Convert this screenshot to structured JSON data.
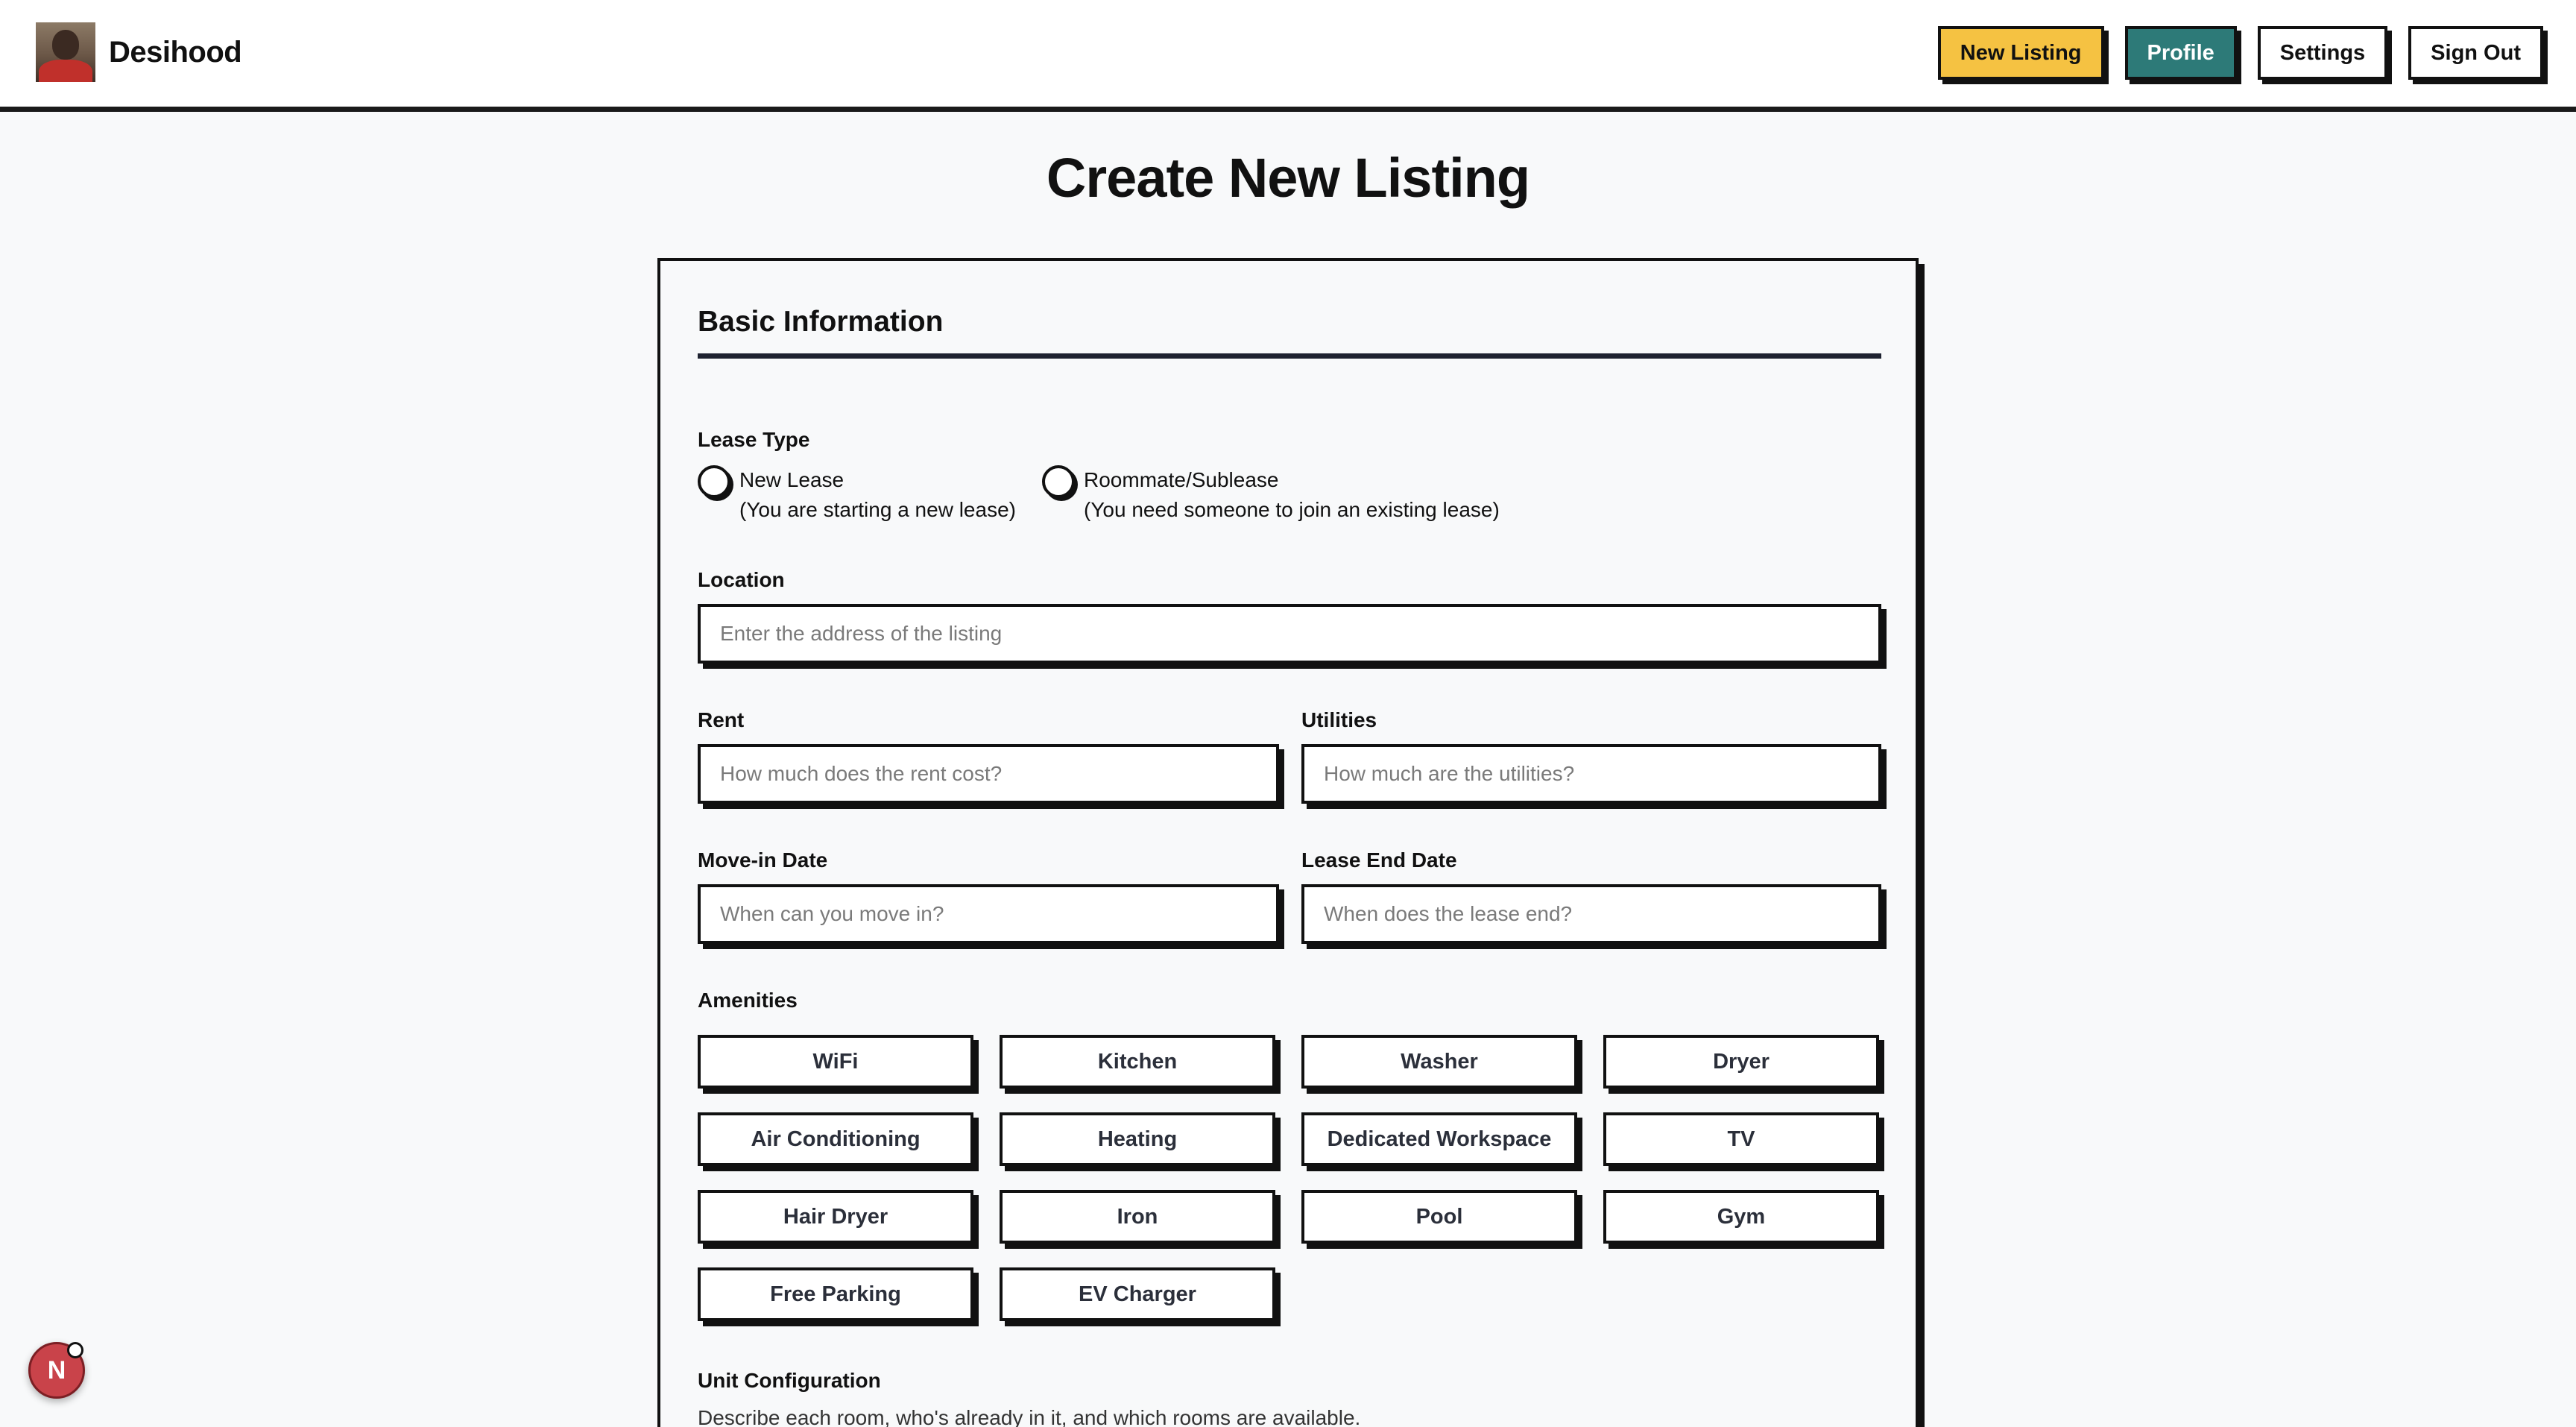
{
  "header": {
    "brand": "Desihood",
    "nav": {
      "new_listing": "New Listing",
      "profile": "Profile",
      "settings": "Settings",
      "sign_out": "Sign Out"
    }
  },
  "page": {
    "title": "Create New Listing"
  },
  "basic_info": {
    "section_title": "Basic Information",
    "lease_type": {
      "label": "Lease Type",
      "options": [
        {
          "title": "New Lease",
          "subtitle": "(You are starting a new lease)"
        },
        {
          "title": "Roommate/Sublease",
          "subtitle": "(You need someone to join an existing lease)"
        }
      ]
    },
    "location": {
      "label": "Location",
      "placeholder": "Enter the address of the listing"
    },
    "rent": {
      "label": "Rent",
      "placeholder": "How much does the rent cost?"
    },
    "utilities": {
      "label": "Utilities",
      "placeholder": "How much are the utilities?"
    },
    "move_in": {
      "label": "Move-in Date",
      "placeholder": "When can you move in?"
    },
    "lease_end": {
      "label": "Lease End Date",
      "placeholder": "When does the lease end?"
    },
    "amenities": {
      "label": "Amenities",
      "items": [
        "WiFi",
        "Kitchen",
        "Washer",
        "Dryer",
        "Air Conditioning",
        "Heating",
        "Dedicated Workspace",
        "TV",
        "Hair Dryer",
        "Iron",
        "Pool",
        "Gym",
        "Free Parking",
        "EV Charger"
      ]
    },
    "unit_config": {
      "label": "Unit Configuration",
      "description": "Describe each room, who's already in it, and which rooms are available."
    }
  },
  "fab": {
    "letter": "N"
  },
  "colors": {
    "accent_yellow": "#f5c242",
    "accent_teal": "#2d7a78",
    "border": "#111111"
  }
}
